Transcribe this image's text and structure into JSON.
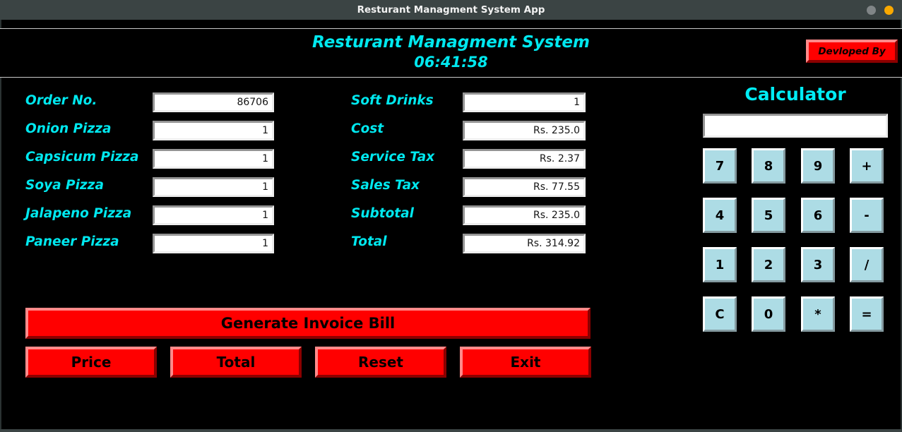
{
  "window": {
    "title": "Resturant Managment System App",
    "controls": [
      {
        "name": "minimize",
        "icon": "minimize-circle-icon"
      },
      {
        "name": "maximize",
        "icon": "maximize-circle-icon"
      }
    ]
  },
  "header": {
    "title": "Resturant Managment System",
    "clock": "06:41:58",
    "developed_by_label": "Devloped By"
  },
  "order_form": {
    "left_column": [
      {
        "label": "Order No.",
        "value": "86706"
      },
      {
        "label": "Onion Pizza",
        "value": "1"
      },
      {
        "label": "Capsicum Pizza",
        "value": "1"
      },
      {
        "label": "Soya Pizza",
        "value": "1"
      },
      {
        "label": "Jalapeno Pizza",
        "value": "1"
      },
      {
        "label": "Paneer Pizza",
        "value": "1"
      }
    ],
    "right_column": [
      {
        "label": "Soft Drinks",
        "value": "1"
      },
      {
        "label": "Cost",
        "value": "Rs. 235.0"
      },
      {
        "label": "Service Tax",
        "value": "Rs. 2.37"
      },
      {
        "label": "Sales Tax",
        "value": "Rs. 77.55"
      },
      {
        "label": "Subtotal",
        "value": "Rs. 235.0"
      },
      {
        "label": "Total",
        "value": "Rs. 314.92"
      }
    ]
  },
  "calculator": {
    "title": "Calculator",
    "display_value": "",
    "keys": [
      "7",
      "8",
      "9",
      "+",
      "4",
      "5",
      "6",
      "-",
      "1",
      "2",
      "3",
      "/",
      "C",
      "0",
      "*",
      "="
    ]
  },
  "actions": {
    "generate": "Generate Invoice Bill",
    "buttons": [
      "Price",
      "Total",
      "Reset",
      "Exit"
    ]
  },
  "colors": {
    "accent_cyan": "#00e8ef",
    "button_red": "#ff0000",
    "calc_key_blue": "#addce5",
    "background": "#000000",
    "titlebar": "#3b4444"
  }
}
